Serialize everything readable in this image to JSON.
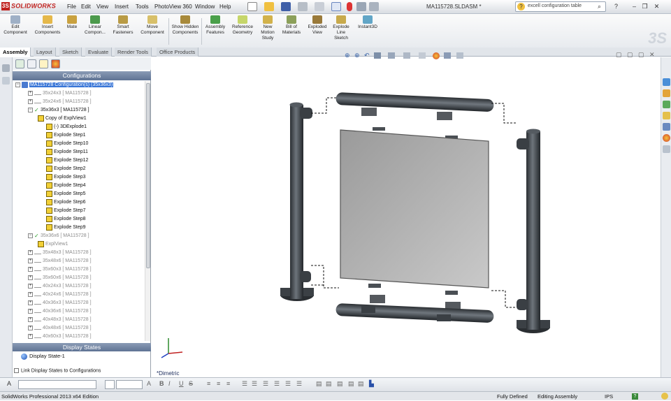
{
  "app": {
    "logo": "SOLIDWORKS",
    "menu": [
      "File",
      "Edit",
      "View",
      "Insert",
      "Tools",
      "PhotoView 360",
      "Window",
      "Help"
    ],
    "document_title": "MA115728.SLDASM *",
    "search_placeholder": "excell configuration table"
  },
  "command_manager": [
    {
      "label": "Edit Component",
      "icon": "edit-component-icon"
    },
    {
      "label": "Insert Components",
      "icon": "insert-components-icon"
    },
    {
      "label": "Mate",
      "icon": "mate-icon"
    },
    {
      "label": "Linear Compon...",
      "icon": "linear-pattern-icon"
    },
    {
      "label": "Smart Fasteners",
      "icon": "smart-fasteners-icon"
    },
    {
      "label": "Move Component",
      "icon": "move-component-icon"
    },
    {
      "label": "Show Hidden Components",
      "icon": "show-hidden-icon"
    },
    {
      "label": "Assembly Features",
      "icon": "assembly-features-icon"
    },
    {
      "label": "Reference Geometry",
      "icon": "reference-geometry-icon"
    },
    {
      "label": "New Motion Study",
      "icon": "motion-study-icon"
    },
    {
      "label": "Bill of Materials",
      "icon": "bom-icon"
    },
    {
      "label": "Exploded View",
      "icon": "exploded-view-icon"
    },
    {
      "label": "Explode Line Sketch",
      "icon": "explode-line-icon"
    },
    {
      "label": "Instant3D",
      "icon": "instant3d-icon"
    }
  ],
  "tabs": [
    "Assembly",
    "Layout",
    "Sketch",
    "Evaluate",
    "Render Tools",
    "Office Products"
  ],
  "active_tab": "Assembly",
  "panel": {
    "configurations_header": "Configurations",
    "display_states_header": "Display States",
    "display_state": "Display State-1",
    "link_label": "Link Display States to Configurations"
  },
  "tree": [
    {
      "text": "MA115728 Configuration(s)  (35x36x3)",
      "level": 0,
      "kind": "root",
      "selected": true
    },
    {
      "text": "35x24x3 [ MA115728 ]",
      "level": 1,
      "kind": "cfg",
      "grey": true
    },
    {
      "text": "35x24x6 [ MA115728 ]",
      "level": 1,
      "kind": "cfg",
      "grey": true
    },
    {
      "text": "35x36x3 [ MA115728 ]",
      "level": 1,
      "kind": "cfg-active"
    },
    {
      "text": "Copy of ExplView1",
      "level": 2,
      "kind": "exp"
    },
    {
      "text": "(-) 3DExplode1",
      "level": 3,
      "kind": "exp"
    },
    {
      "text": "Explode Step1",
      "level": 3,
      "kind": "exp"
    },
    {
      "text": "Explode Step10",
      "level": 3,
      "kind": "exp"
    },
    {
      "text": "Explode Step11",
      "level": 3,
      "kind": "exp"
    },
    {
      "text": "Explode Step12",
      "level": 3,
      "kind": "exp"
    },
    {
      "text": "Explode Step2",
      "level": 3,
      "kind": "exp"
    },
    {
      "text": "Explode Step3",
      "level": 3,
      "kind": "exp"
    },
    {
      "text": "Explode Step4",
      "level": 3,
      "kind": "exp"
    },
    {
      "text": "Explode Step5",
      "level": 3,
      "kind": "exp"
    },
    {
      "text": "Explode Step6",
      "level": 3,
      "kind": "exp"
    },
    {
      "text": "Explode Step7",
      "level": 3,
      "kind": "exp"
    },
    {
      "text": "Explode Step8",
      "level": 3,
      "kind": "exp"
    },
    {
      "text": "Explode Step9",
      "level": 3,
      "kind": "exp"
    },
    {
      "text": "35x36x6 [ MA115728 ]",
      "level": 1,
      "kind": "cfg-check",
      "grey": true
    },
    {
      "text": "ExplView1",
      "level": 2,
      "kind": "exp",
      "grey": true
    },
    {
      "text": "35x48x3 [ MA115728 ]",
      "level": 1,
      "kind": "cfg",
      "grey": true
    },
    {
      "text": "35x48x6 [ MA115728 ]",
      "level": 1,
      "kind": "cfg",
      "grey": true
    },
    {
      "text": "35x60x3 [ MA115728 ]",
      "level": 1,
      "kind": "cfg",
      "grey": true
    },
    {
      "text": "35x60x6 [ MA115728 ]",
      "level": 1,
      "kind": "cfg",
      "grey": true
    },
    {
      "text": "40x24x3 [ MA115728 ]",
      "level": 1,
      "kind": "cfg",
      "grey": true
    },
    {
      "text": "40x24x6 [ MA115728 ]",
      "level": 1,
      "kind": "cfg",
      "grey": true
    },
    {
      "text": "40x36x3 [ MA115728 ]",
      "level": 1,
      "kind": "cfg",
      "grey": true
    },
    {
      "text": "40x36x6 [ MA115728 ]",
      "level": 1,
      "kind": "cfg",
      "grey": true
    },
    {
      "text": "40x48x3 [ MA115728 ]",
      "level": 1,
      "kind": "cfg",
      "grey": true
    },
    {
      "text": "40x48x6 [ MA115728 ]",
      "level": 1,
      "kind": "cfg",
      "grey": true
    },
    {
      "text": "40x60x3 [ MA115728 ]",
      "level": 1,
      "kind": "cfg",
      "grey": true
    }
  ],
  "viewport": {
    "view_label": "*Dimetric"
  },
  "status": {
    "edition": "SolidWorks Professional 2013 x64 Edition",
    "state": "Fully Defined",
    "mode": "Editing Assembly",
    "units": "IPS"
  }
}
